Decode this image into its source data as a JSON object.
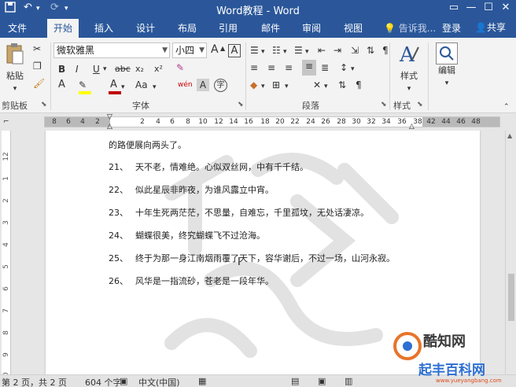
{
  "titlebar": {
    "title": "Word教程 - Word",
    "undo_icon": "undo-icon",
    "redo_icon": "redo-icon"
  },
  "tabs": {
    "items": [
      "文件",
      "开始",
      "插入",
      "设计",
      "布局",
      "引用",
      "邮件",
      "审阅",
      "视图"
    ],
    "active": "开始",
    "tell_me": "告诉我...",
    "sign_in": "登录",
    "share": "共享"
  },
  "ribbon": {
    "clipboard": {
      "paste": "粘贴",
      "label": "剪贴板"
    },
    "font": {
      "font_name": "微软雅黑",
      "font_size": "小四",
      "bold": "B",
      "italic": "I",
      "underline": "U",
      "strike": "abc",
      "subscript": "x₂",
      "superscript": "x²",
      "grow": "A",
      "shrink": "A",
      "change_case": "Aa",
      "font_color": "A",
      "char_shading": "A",
      "phonetic": "wén",
      "enclose": "字",
      "label": "字体"
    },
    "paragraph": {
      "label": "段落"
    },
    "styles": {
      "button": "样式",
      "label": "样式"
    },
    "editing": {
      "button": "编辑"
    }
  },
  "ruler": {
    "numbers": [
      "8",
      "6",
      "4",
      "2",
      "2",
      "4",
      "6",
      "8",
      "10",
      "12",
      "14",
      "16",
      "18",
      "20",
      "22",
      "24",
      "26",
      "28",
      "30",
      "32",
      "34",
      "36",
      "38",
      "42",
      "44",
      "46",
      "48"
    ]
  },
  "vruler": {
    "numbers": [
      "12",
      "1",
      "2",
      "3",
      "4",
      "5",
      "6",
      "7",
      "8",
      "9",
      "10"
    ]
  },
  "document": {
    "first_line": "的路便展向两头了。",
    "items": [
      {
        "num": "21、",
        "text": "天不老，情难绝。心似双丝网，中有千千结。"
      },
      {
        "num": "22、",
        "text": "似此星辰非昨夜，为谁风露立中宵。"
      },
      {
        "num": "23、",
        "text": "十年生死两茫茫，不思量，自难忘，千里孤坟，无处话凄凉。"
      },
      {
        "num": "24、",
        "text": "蝴蝶很美，终究蝴蝶飞不过沧海。"
      },
      {
        "num": "25、",
        "text": "终于为那一身江南烟雨覆了天下，容华谢后，不过一场，山河永寂。"
      },
      {
        "num": "26、",
        "text": "风华是一指流砂，苍老是一段年华。"
      }
    ]
  },
  "status": {
    "page": "第 2 页，共 2 页",
    "words": "604 个字",
    "language": "中文(中国)"
  },
  "logo": {
    "brand": "酷知网",
    "brand2": "起丰百科网",
    "url": "www.yueyangbang.com"
  },
  "colors": {
    "title_bar": "#2b579a",
    "highlight": "#ffff00",
    "font_color": "#c00000"
  }
}
